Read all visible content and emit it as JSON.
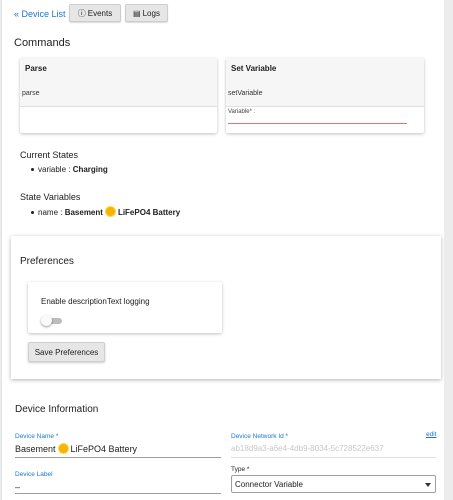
{
  "topbar": {
    "back_link": "« Device List",
    "events_label": "Events",
    "logs_label": "Logs"
  },
  "commands": {
    "heading": "Commands",
    "items": [
      {
        "title": "Parse",
        "name": "parse"
      },
      {
        "title": "Set Variable",
        "name": "setVariable",
        "param_label": "Variable* :"
      }
    ]
  },
  "current_states": {
    "heading": "Current States",
    "items": [
      {
        "key": "variable",
        "value": "Charging"
      }
    ]
  },
  "state_variables": {
    "heading": "State Variables",
    "items": [
      {
        "key": "name",
        "value_prefix": "Basement",
        "value_suffix": "LiFePO4 Battery"
      }
    ]
  },
  "preferences": {
    "heading": "Preferences",
    "toggle_label": "Enable descriptionText logging",
    "toggle_on": false,
    "save_label": "Save Preferences"
  },
  "device_info": {
    "heading": "Device Information",
    "device_name_label": "Device Name *",
    "device_name_prefix": "Basement",
    "device_name_suffix": "LiFePO4 Battery",
    "network_id_label": "Device Network Id *",
    "network_id_value": "ab18d9a3-a6e4-4db9-8034-5c728522e637",
    "edit_label": "edit",
    "device_label_label": "Device Label",
    "device_label_value": "–",
    "type_label": "Type *",
    "type_value": "Connector Variable"
  },
  "colors": {
    "accent": "#1976d2",
    "error_underline": "#e57373",
    "sun_emoji": "#f5b400"
  }
}
